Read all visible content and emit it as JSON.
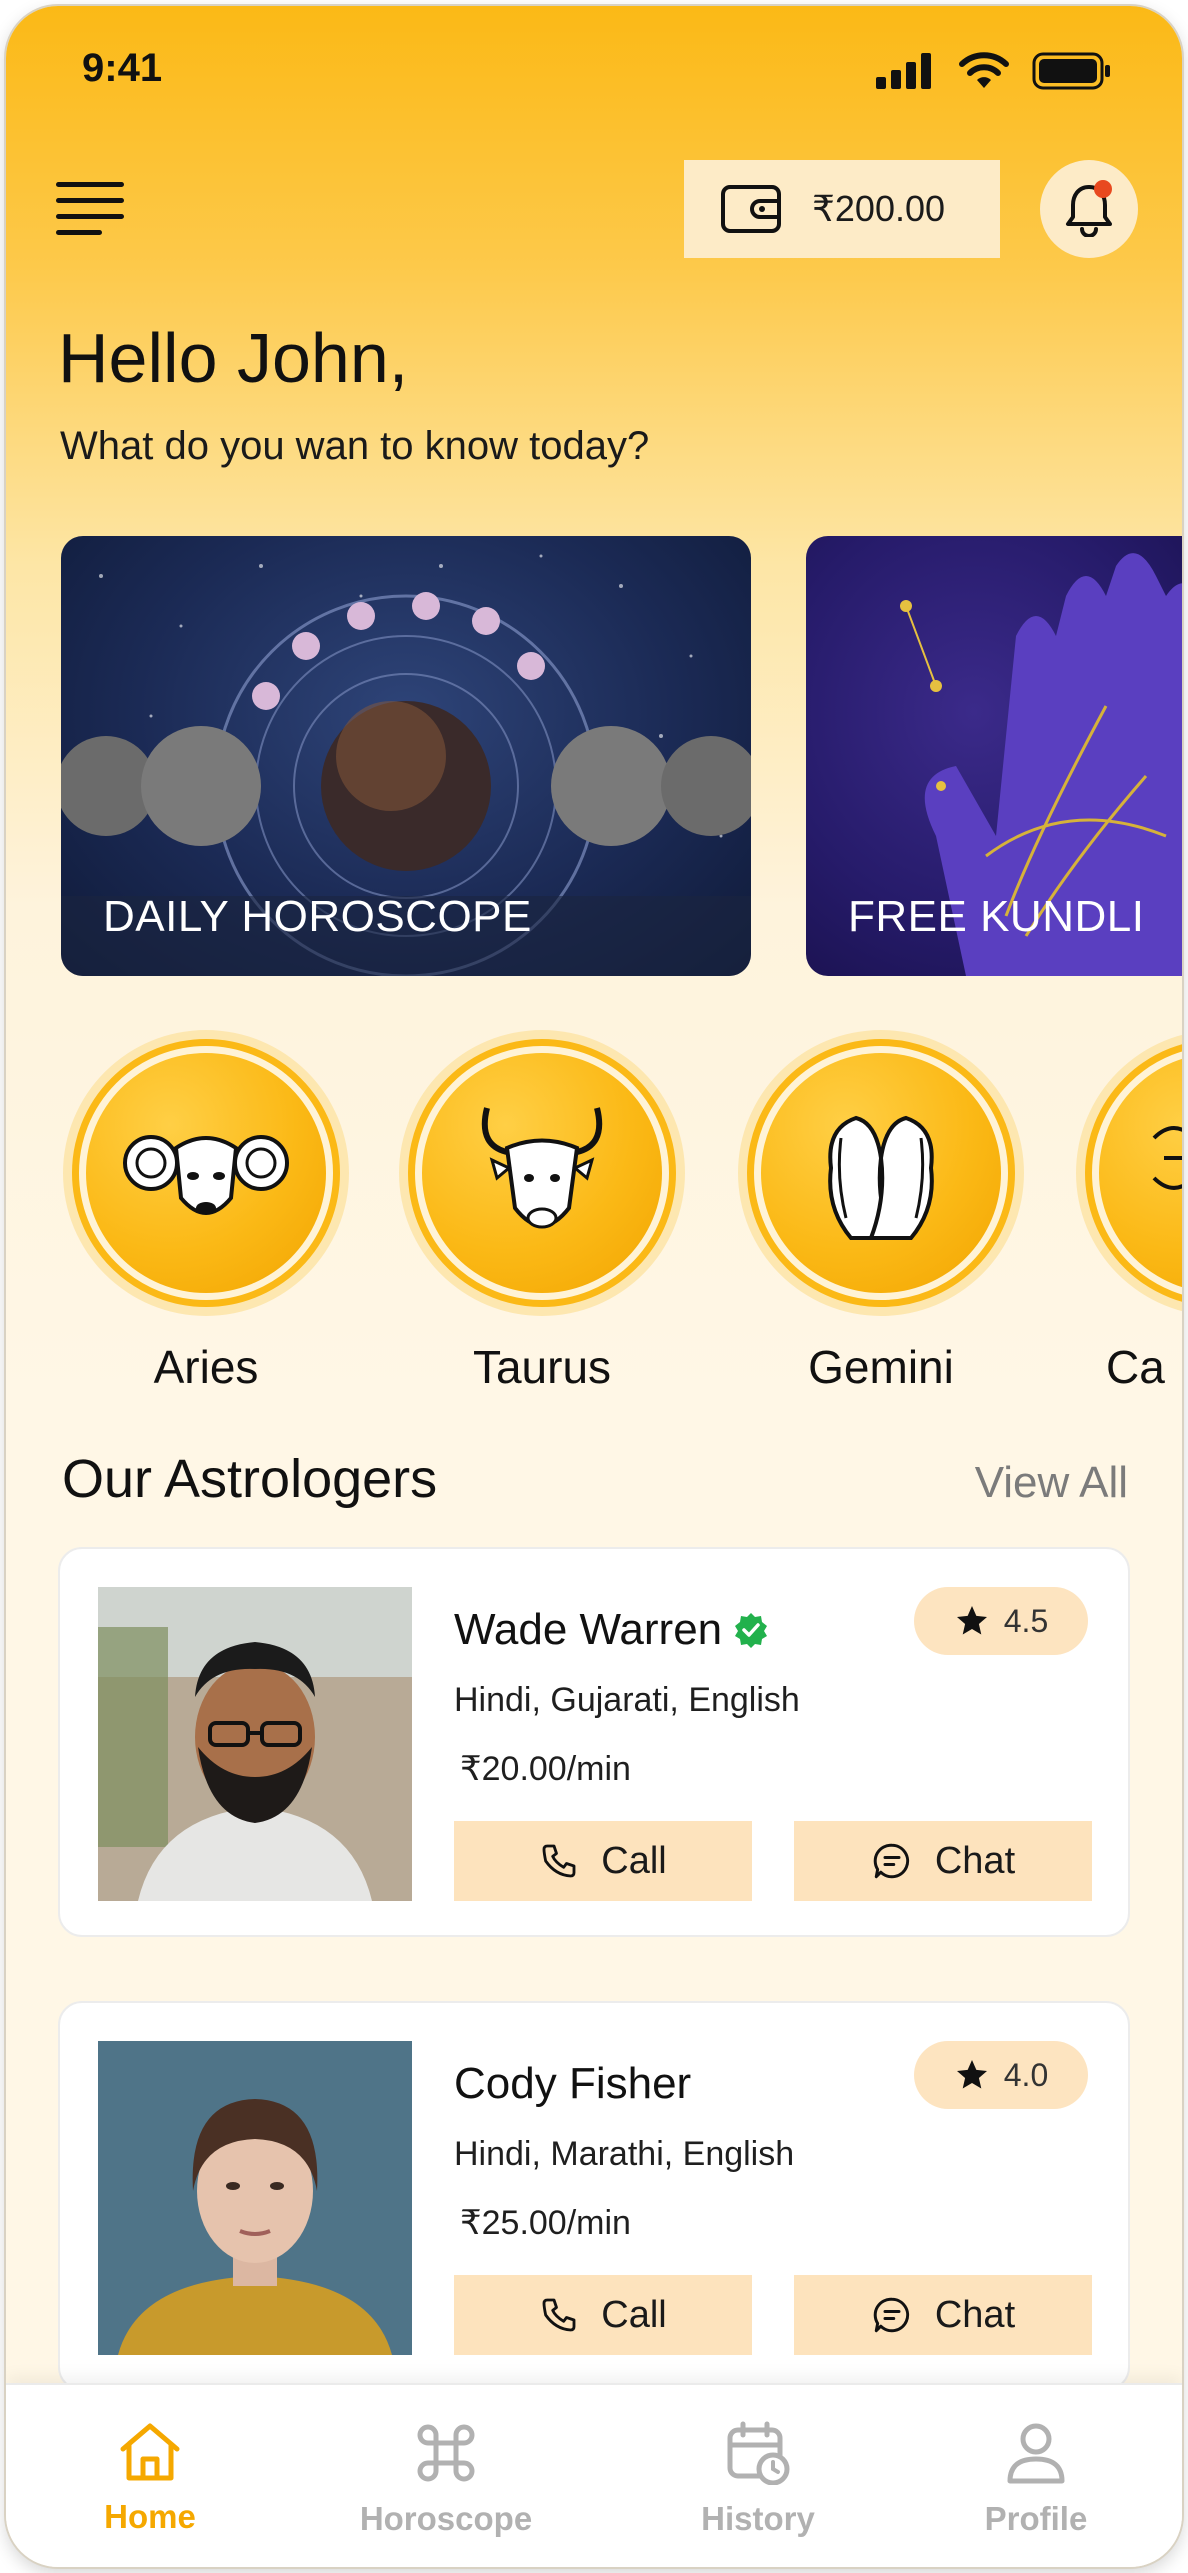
{
  "status_bar": {
    "time": "9:41"
  },
  "header": {
    "wallet_amount": "₹200.00"
  },
  "greeting": {
    "title": "Hello John,",
    "subtitle": "What do you wan to know today?"
  },
  "banners": [
    {
      "label": "DAILY HOROSCOPE"
    },
    {
      "label": "FREE KUNDLI"
    }
  ],
  "zodiac": [
    {
      "name": "Aries"
    },
    {
      "name": "Taurus"
    },
    {
      "name": "Gemini"
    },
    {
      "name": "Ca"
    }
  ],
  "astrologers_section": {
    "title": "Our Astrologers",
    "view_all": "View All"
  },
  "astrologers": [
    {
      "name": "Wade Warren",
      "verified": true,
      "languages": "Hindi, Gujarati, English",
      "price": "₹20.00/min",
      "rating": "4.5",
      "call_label": "Call",
      "chat_label": "Chat"
    },
    {
      "name": "Cody Fisher",
      "verified": false,
      "languages": "Hindi, Marathi, English",
      "price": "₹25.00/min",
      "rating": "4.0",
      "call_label": "Call",
      "chat_label": "Chat"
    }
  ],
  "bottom_nav": [
    {
      "label": "Home",
      "icon": "home-icon",
      "active": true
    },
    {
      "label": "Horoscope",
      "icon": "command-icon",
      "active": false
    },
    {
      "label": "History",
      "icon": "calendar-clock-icon",
      "active": false
    },
    {
      "label": "Profile",
      "icon": "user-icon",
      "active": false
    }
  ],
  "colors": {
    "accent": "#fbb916",
    "nav_active": "#f5a800",
    "button_bg": "#fde3bd",
    "verified": "#22b14c"
  }
}
